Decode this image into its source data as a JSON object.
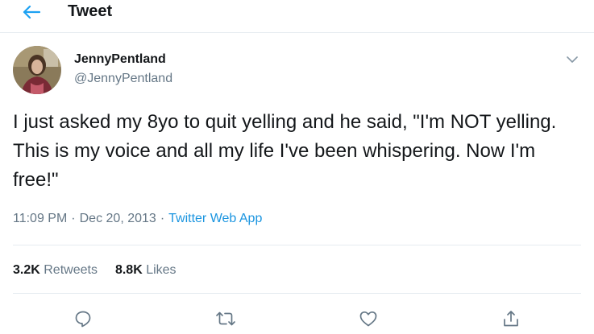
{
  "header": {
    "back_icon": "arrow-left-icon",
    "title": "Tweet"
  },
  "tweet": {
    "author": {
      "name": "JennyPentland",
      "handle": "@JennyPentland",
      "avatar_icon": "profile-photo"
    },
    "menu_icon": "chevron-down-icon",
    "text": "I just asked my 8yo to quit yelling and he said, \"I'm NOT yelling. This is my voice and all my life I've been whispering. Now I'm free!\"",
    "time": "11:09 PM",
    "separator": "·",
    "date": "Dec 20, 2013",
    "source": "Twitter Web App",
    "stats": {
      "retweets_count": "3.2K",
      "retweets_label": "Retweets",
      "likes_count": "8.8K",
      "likes_label": "Likes"
    },
    "actions": [
      {
        "name": "reply",
        "icon": "speech-bubble-icon"
      },
      {
        "name": "retweet",
        "icon": "retweet-arrows-icon"
      },
      {
        "name": "like",
        "icon": "heart-icon"
      },
      {
        "name": "share",
        "icon": "share-upload-icon"
      }
    ]
  },
  "colors": {
    "accent": "#1da1f2",
    "link": "#1b95e0",
    "text_primary": "#14171a",
    "text_secondary": "#657786",
    "divider": "#e6ecf0"
  }
}
